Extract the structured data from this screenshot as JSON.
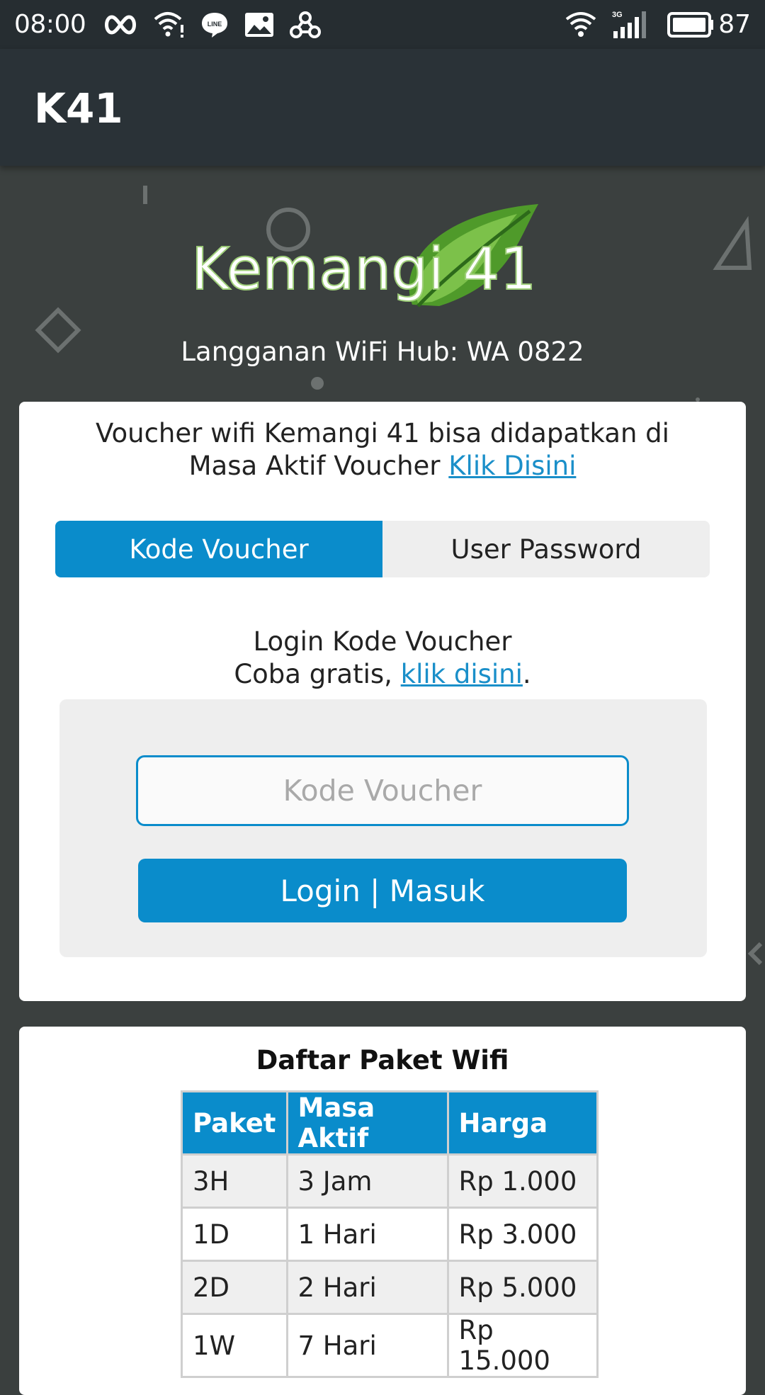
{
  "status_bar": {
    "time": "08:00",
    "battery": "87",
    "network": "3G"
  },
  "app_bar": {
    "title": "K41"
  },
  "header": {
    "logo_text": "Kemangi 41",
    "subscribe_text": "Langganan WiFi Hub: WA 0822"
  },
  "intro": {
    "line1": "Voucher wifi Kemangi 41 bisa didapatkan di",
    "line2_prefix": "Masa Aktif Voucher ",
    "line2_link": "Klik Disini"
  },
  "tabs": [
    {
      "label": "Kode Voucher",
      "active": true
    },
    {
      "label": "User Password",
      "active": false
    }
  ],
  "login": {
    "heading": "Login Kode Voucher",
    "trial_prefix": "Coba gratis, ",
    "trial_link": "klik disini",
    "trial_suffix": ".",
    "input_placeholder": "Kode Voucher",
    "input_value": "",
    "button_label": "Login | Masuk"
  },
  "packages": {
    "title": "Daftar Paket Wifi",
    "columns": [
      "Paket",
      "Masa Aktif",
      "Harga"
    ],
    "rows": [
      [
        "3H",
        "3 Jam",
        "Rp 1.000"
      ],
      [
        "1D",
        "1 Hari",
        "Rp 3.000"
      ],
      [
        "2D",
        "2 Hari",
        "Rp 5.000"
      ],
      [
        "1W",
        "7 Hari",
        "Rp 15.000"
      ]
    ]
  },
  "colors": {
    "accent": "#0a8ccb",
    "link": "#1a8fc9",
    "app_bar": "#2a3237",
    "status_bar": "#262d31",
    "background": "#3b403f"
  }
}
